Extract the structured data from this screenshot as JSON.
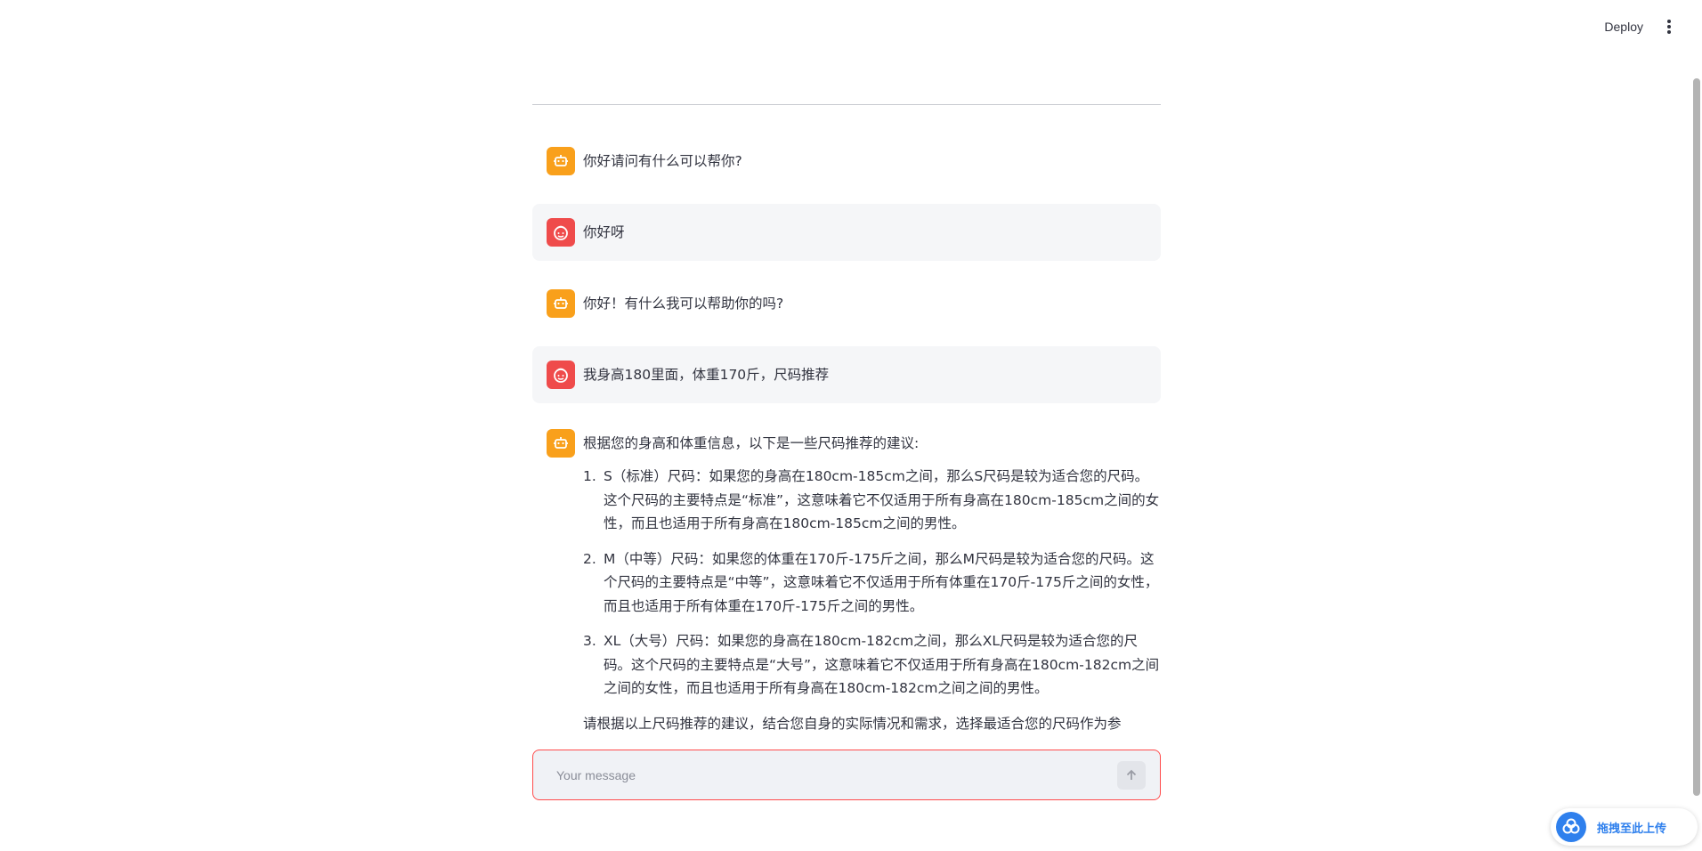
{
  "header": {
    "deploy_label": "Deploy",
    "menu_icon": "kebab-menu-icon"
  },
  "page": {
    "title_fragment": "· · · · · · · ·"
  },
  "messages": [
    {
      "role": "assistant",
      "icon": "robot-icon",
      "text": "你好请问有什么可以帮你?"
    },
    {
      "role": "user",
      "icon": "user-face-icon",
      "text": "你好呀"
    },
    {
      "role": "assistant",
      "icon": "robot-icon",
      "text": "你好！有什么我可以帮助你的吗?"
    },
    {
      "role": "user",
      "icon": "user-face-icon",
      "text": "我身高180里面，体重170斤，尺码推荐"
    }
  ],
  "reply": {
    "icon": "robot-icon",
    "intro": "根据您的身高和体重信息，以下是一些尺码推荐的建议:",
    "items": [
      {
        "num": "1.",
        "text": "S（标准）尺码：如果您的身高在180cm-185cm之间，那么S尺码是较为适合您的尺码。这个尺码的主要特点是“标准”，这意味着它不仅适用于所有身高在180cm-185cm之间的女性，而且也适用于所有身高在180cm-185cm之间的男性。"
      },
      {
        "num": "2.",
        "text": "M（中等）尺码：如果您的体重在170斤-175斤之间，那么M尺码是较为适合您的尺码。这个尺码的主要特点是“中等”，这意味着它不仅适用于所有体重在170斤-175斤之间的女性，而且也适用于所有体重在170斤-175斤之间的男性。"
      },
      {
        "num": "3.",
        "text": "XL（大号）尺码：如果您的身高在180cm-182cm之间，那么XL尺码是较为适合您的尺码。这个尺码的主要特点是“大号”，这意味着它不仅适用于所有身高在180cm-182cm之间之间的女性，而且也适用于所有身高在180cm-182cm之间之间的男性。"
      }
    ],
    "outro": "请根据以上尺码推荐的建议，结合您自身的实际情况和需求，选择最适合您的尺码作为参"
  },
  "chat_input": {
    "placeholder": "Your message",
    "value": "",
    "send_icon": "arrow-up-icon"
  },
  "upload_widget": {
    "icon": "cloud-upload-icon",
    "label": "拖拽至此上传"
  },
  "colors": {
    "assistant_avatar": "#f9a01b",
    "user_avatar": "#ef4b4b",
    "input_border": "#ff4b4b",
    "upload_accent": "#2f80ed"
  }
}
